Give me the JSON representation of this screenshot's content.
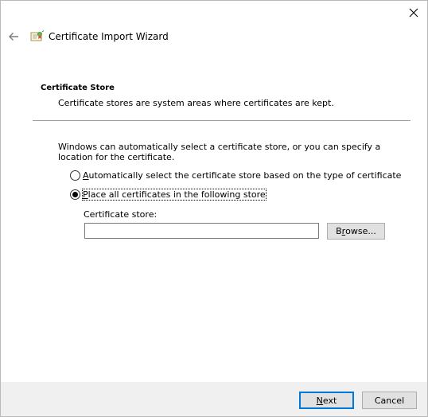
{
  "window": {
    "close_icon": "close-icon"
  },
  "header": {
    "back_icon": "back-arrow-icon",
    "app_icon": "certificate-icon",
    "title": "Certificate Import Wizard"
  },
  "section": {
    "title": "Certificate Store",
    "description": "Certificate stores are system areas where certificates are kept."
  },
  "content": {
    "intro": "Windows can automatically select a certificate store, or you can specify a location for the certificate.",
    "options": [
      {
        "access_key": "A",
        "rest": "utomatically select the certificate store based on the type of certificate",
        "selected": false
      },
      {
        "access_key": "P",
        "rest": "lace all certificates in the following store",
        "selected": true
      }
    ],
    "store_label": "Certificate store:",
    "store_value": "",
    "browse_button": {
      "access_key": "r",
      "before": "B",
      "after": "owse..."
    }
  },
  "footer": {
    "next_button": {
      "access_key": "N",
      "rest": "ext"
    },
    "cancel_button": "Cancel"
  },
  "colors": {
    "default_button_border": "#0078d7",
    "footer_background": "#f0f0f0",
    "button_background": "#e1e1e1"
  }
}
